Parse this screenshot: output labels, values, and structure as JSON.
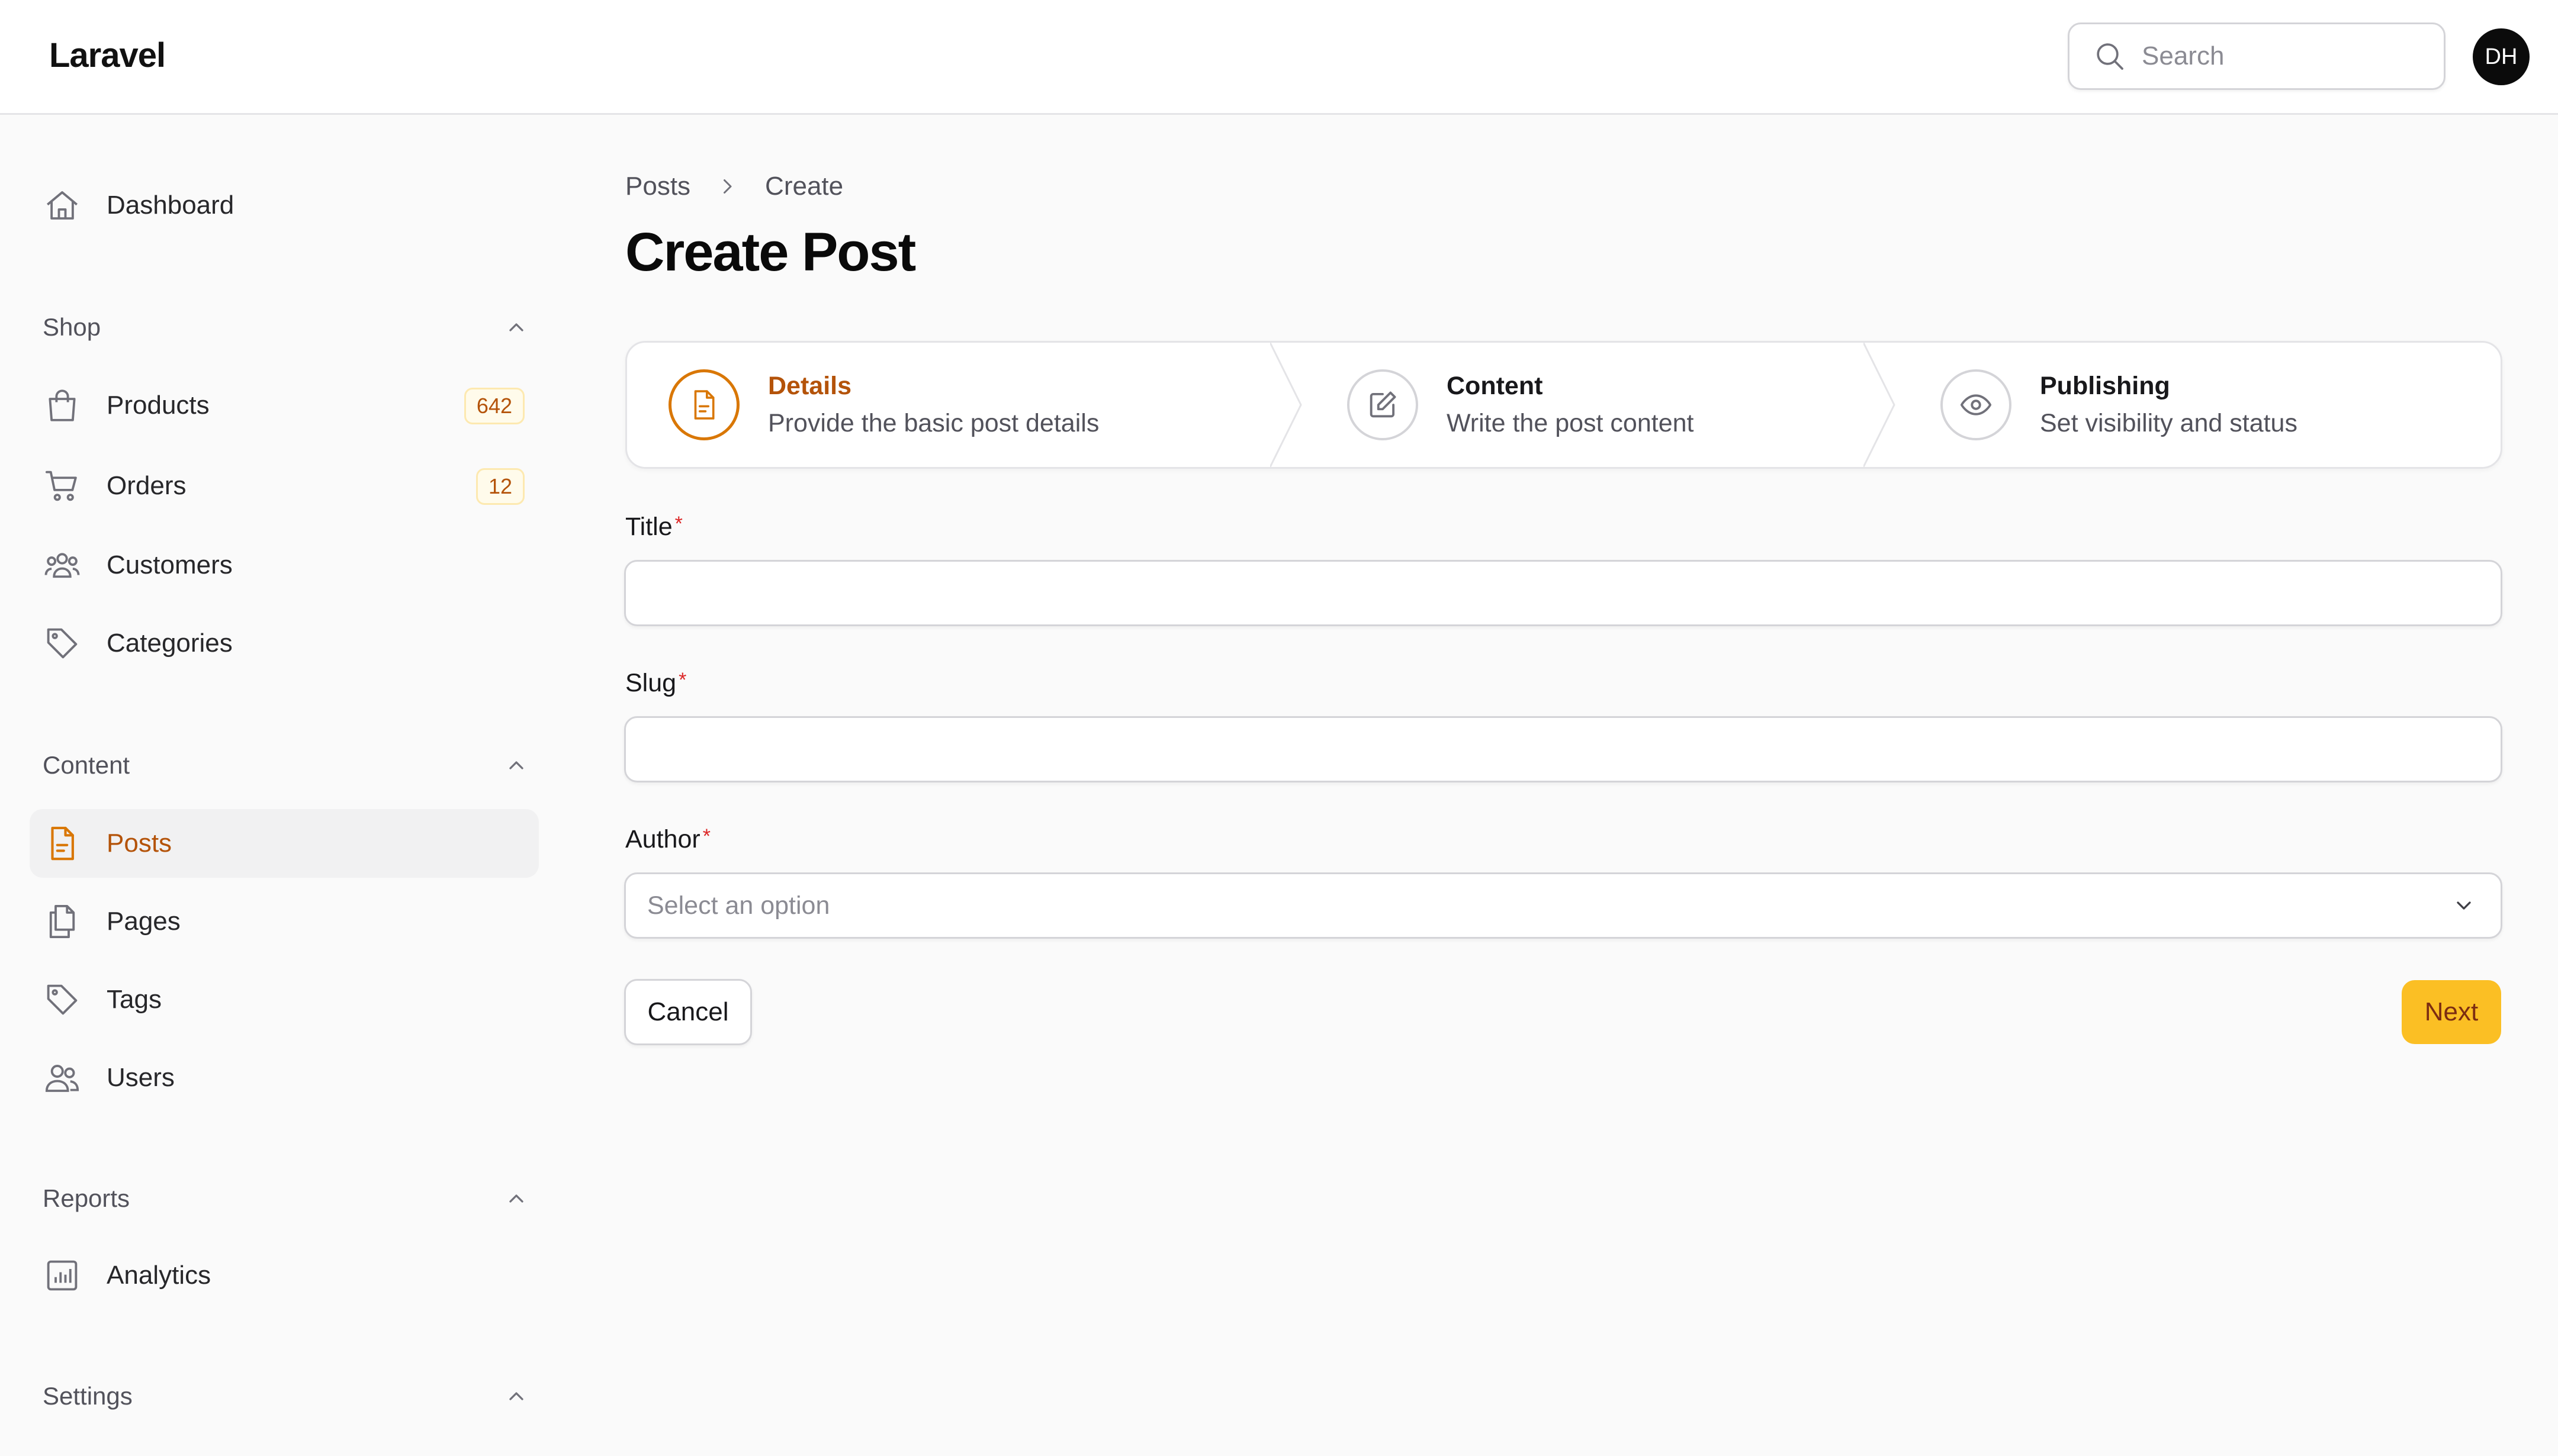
{
  "app": {
    "brand": "Laravel"
  },
  "header": {
    "search_placeholder": "Search",
    "avatar_initials": "DH"
  },
  "sidebar": {
    "dashboard": {
      "label": "Dashboard",
      "icon": "home-icon"
    },
    "groups": {
      "shop": {
        "label": "Shop",
        "items": [
          {
            "label": "Products",
            "icon": "shopping-bag-icon",
            "badge": "642"
          },
          {
            "label": "Orders",
            "icon": "shopping-cart-icon",
            "badge": "12"
          },
          {
            "label": "Customers",
            "icon": "user-group-icon"
          },
          {
            "label": "Categories",
            "icon": "tag-icon"
          }
        ]
      },
      "content": {
        "label": "Content",
        "items": [
          {
            "label": "Posts",
            "icon": "document-text-icon",
            "active": true
          },
          {
            "label": "Pages",
            "icon": "documents-icon"
          },
          {
            "label": "Tags",
            "icon": "tag-icon"
          },
          {
            "label": "Users",
            "icon": "users-icon"
          }
        ]
      },
      "reports": {
        "label": "Reports",
        "items": [
          {
            "label": "Analytics",
            "icon": "chart-bar-icon"
          }
        ]
      },
      "settings": {
        "label": "Settings"
      }
    }
  },
  "breadcrumb": {
    "items": [
      "Posts",
      "Create"
    ]
  },
  "page": {
    "title": "Create Post"
  },
  "wizard": {
    "steps": [
      {
        "title": "Details",
        "description": "Provide the basic post details",
        "icon": "document-text-icon",
        "current": true
      },
      {
        "title": "Content",
        "description": "Write the post content",
        "icon": "pencil-square-icon"
      },
      {
        "title": "Publishing",
        "description": "Set visibility and status",
        "icon": "eye-icon"
      }
    ]
  },
  "form": {
    "title_label": "Title",
    "slug_label": "Slug",
    "author_label": "Author",
    "required_mark": "*",
    "title_value": "",
    "slug_value": "",
    "author_placeholder": "Select an option"
  },
  "actions": {
    "cancel": "Cancel",
    "next": "Next"
  },
  "colors": {
    "accent": "#d97706",
    "accent_text": "#b45309",
    "primary_button": "#fbbf24",
    "required": "#dc2626"
  }
}
